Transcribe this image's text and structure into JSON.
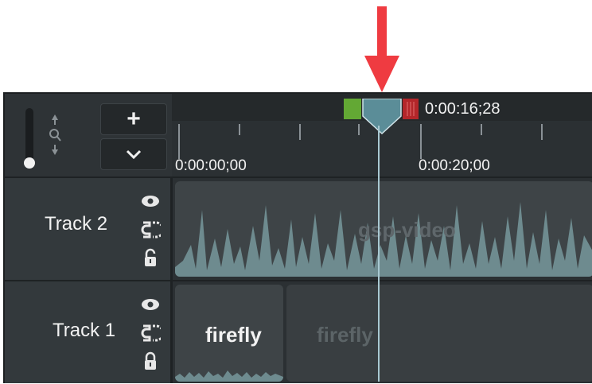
{
  "annotation": {
    "icon": "down-arrow-icon",
    "color": "#ef3b41"
  },
  "controls": {
    "add_label": "+",
    "add_icon": "plus-icon",
    "more_icon": "chevron-down-icon",
    "zoom_icon": "zoom-icon",
    "slider_icon": "slider-knob"
  },
  "ruler": {
    "start_label": "0:00:00;00",
    "mid_label": "0:00:20;00",
    "playhead_time": "0:00:16;28"
  },
  "tracks": [
    {
      "name": "Track 2",
      "icons": [
        "eye-icon",
        "magnet-icon",
        "lock-icon"
      ],
      "clips": [
        {
          "label": "gsp-video",
          "type": "audio-waveform"
        }
      ]
    },
    {
      "name": "Track 1",
      "icons": [
        "eye-icon",
        "magnet-icon",
        "lock-icon"
      ],
      "clips": [
        {
          "label": "firefly",
          "type": "audio"
        },
        {
          "label": "firefly",
          "type": "audio"
        }
      ]
    }
  ],
  "colors": {
    "panel_bg": "#2b3033",
    "mark_in": "#63a834",
    "mark_out": "#b3262a",
    "playhead": "#5b8d98",
    "waveform": "#6e8b8f"
  }
}
